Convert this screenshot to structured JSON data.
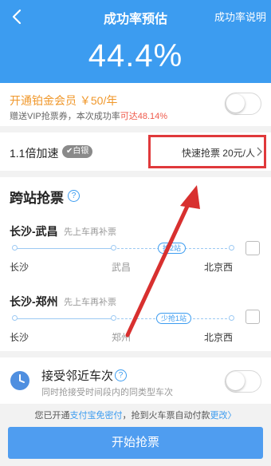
{
  "header": {
    "title": "成功率预估",
    "help_label": "成功率说明",
    "success_rate": "44.4%"
  },
  "vip": {
    "title": "开通铂金会员 ￥50/年",
    "desc_prefix": "赠送VIP抢票券，本次成功率",
    "desc_highlight": "可达48.14%",
    "toggle_on": false
  },
  "speed": {
    "label": "1.1倍加速",
    "badge": "白银",
    "option": "快速抢票 20元/人"
  },
  "transfer": {
    "title": "跨站抢票",
    "routes": [
      {
        "name": "长沙-武昌",
        "hint": "先上车再补票",
        "from": "长沙",
        "via": "武昌",
        "to": "北京西",
        "tag": "抢2站"
      },
      {
        "name": "长沙-郑州",
        "hint": "先上车再补票",
        "from": "长沙",
        "via": "郑州",
        "to": "北京西",
        "tag": "少抢1站"
      }
    ]
  },
  "nearby": {
    "title": "接受邻近车次",
    "desc": "同时抢接受时间段内的同类型车次",
    "toggle_on": false
  },
  "notice": {
    "prefix": "您已开通",
    "link": "支付宝免密付",
    "middle": "，抢到火车票自动付款",
    "change": "更改"
  },
  "actions": {
    "start": "开始抢票"
  },
  "colors": {
    "primary": "#3c9cf0",
    "highlight": "#e0393b",
    "vip": "#f0972a"
  }
}
